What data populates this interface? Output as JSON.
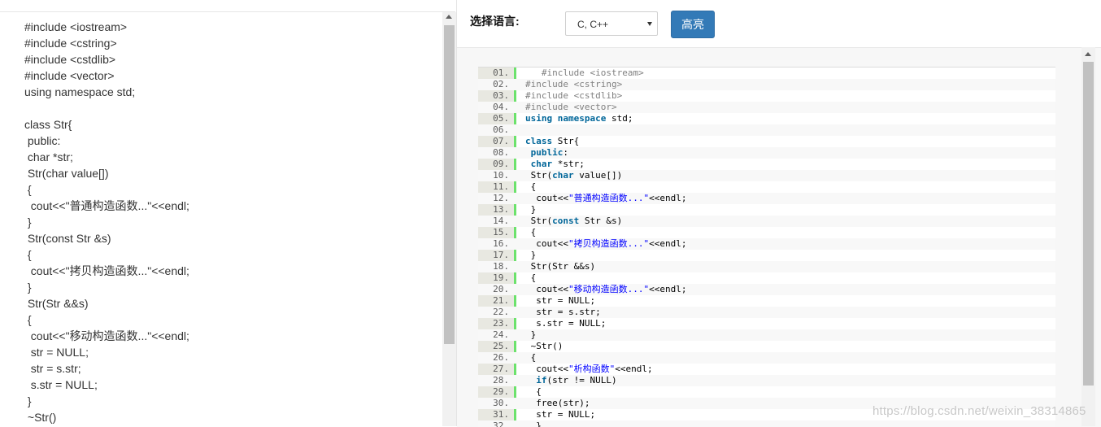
{
  "editor": {
    "left_text": "#include <iostream>\n#include <cstring>\n#include <cstdlib>\n#include <vector>\nusing namespace std;\n\nclass Str{\n public:\n char *str;\n Str(char value[])\n {\n  cout<<\"普通构造函数...\"<<endl;\n }\n Str(const Str &s)\n {\n  cout<<\"拷贝构造函数...\"<<endl;\n }\n Str(Str &&s)\n {\n  cout<<\"移动构造函数...\"<<endl;\n  str = NULL;\n  str = s.str;\n  s.str = NULL;\n }\n ~Str()"
  },
  "toolbar": {
    "language_label": "选择语言:",
    "language_selected": "C, C++",
    "highlight_button": "高亮"
  },
  "highlighted": {
    "lines": [
      {
        "n": "01.",
        "t": "   #include <iostream>"
      },
      {
        "n": "02.",
        "t": "#include <cstring>"
      },
      {
        "n": "03.",
        "t": "#include <cstdlib>"
      },
      {
        "n": "04.",
        "t": "#include <vector>"
      },
      {
        "n": "05.",
        "t": "using namespace std;"
      },
      {
        "n": "06.",
        "t": ""
      },
      {
        "n": "07.",
        "t": "class Str{"
      },
      {
        "n": "08.",
        "t": " public:"
      },
      {
        "n": "09.",
        "t": " char *str;"
      },
      {
        "n": "10.",
        "t": " Str(char value[])"
      },
      {
        "n": "11.",
        "t": " {"
      },
      {
        "n": "12.",
        "t": "  cout<<\"普通构造函数...\"<<endl;"
      },
      {
        "n": "13.",
        "t": " }"
      },
      {
        "n": "14.",
        "t": " Str(const Str &s)"
      },
      {
        "n": "15.",
        "t": " {"
      },
      {
        "n": "16.",
        "t": "  cout<<\"拷贝构造函数...\"<<endl;"
      },
      {
        "n": "17.",
        "t": " }"
      },
      {
        "n": "18.",
        "t": " Str(Str &&s)"
      },
      {
        "n": "19.",
        "t": " {"
      },
      {
        "n": "20.",
        "t": "  cout<<\"移动构造函数...\"<<endl;"
      },
      {
        "n": "21.",
        "t": "  str = NULL;"
      },
      {
        "n": "22.",
        "t": "  str = s.str;"
      },
      {
        "n": "23.",
        "t": "  s.str = NULL;"
      },
      {
        "n": "24.",
        "t": " }"
      },
      {
        "n": "25.",
        "t": " ~Str()"
      },
      {
        "n": "26.",
        "t": " {"
      },
      {
        "n": "27.",
        "t": "  cout<<\"析构函数\"<<endl;"
      },
      {
        "n": "28.",
        "t": "  if(str != NULL)"
      },
      {
        "n": "29.",
        "t": "  {"
      },
      {
        "n": "30.",
        "t": "  free(str);"
      },
      {
        "n": "31.",
        "t": "  str = NULL;"
      },
      {
        "n": "32.",
        "t": "  }"
      }
    ]
  },
  "watermark": "https://blog.csdn.net/weixin_38314865",
  "colors": {
    "accent_button": "#337ab7",
    "gutter_border": "#6ce26c",
    "keyword": "#006699",
    "string": "#0000ff",
    "preprocessor": "#808080"
  }
}
